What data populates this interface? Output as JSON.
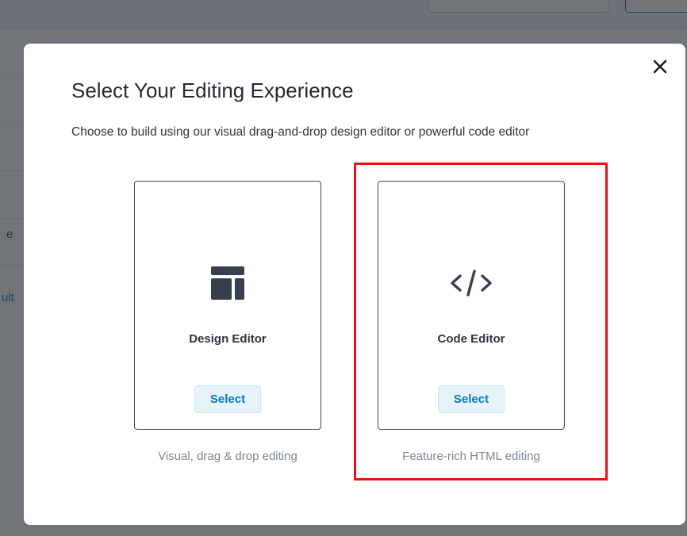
{
  "background": {
    "partial_text_1": "e",
    "partial_text_2": "ult"
  },
  "modal": {
    "title": "Select Your Editing Experience",
    "subtitle": "Choose to build using our visual drag-and-drop design editor or powerful code editor",
    "close_icon": "close-icon",
    "options": [
      {
        "icon": "layout-template-icon",
        "label": "Design Editor",
        "button_label": "Select",
        "caption": "Visual, drag & drop editing"
      },
      {
        "icon": "code-brackets-icon",
        "label": "Code Editor",
        "button_label": "Select",
        "caption": "Feature-rich HTML editing",
        "highlighted": true
      }
    ]
  },
  "colors": {
    "accent": "#0b79b8",
    "select_button_bg": "#e6f3fb",
    "highlight": "#ee1111",
    "text_dark": "#1f2a36"
  }
}
